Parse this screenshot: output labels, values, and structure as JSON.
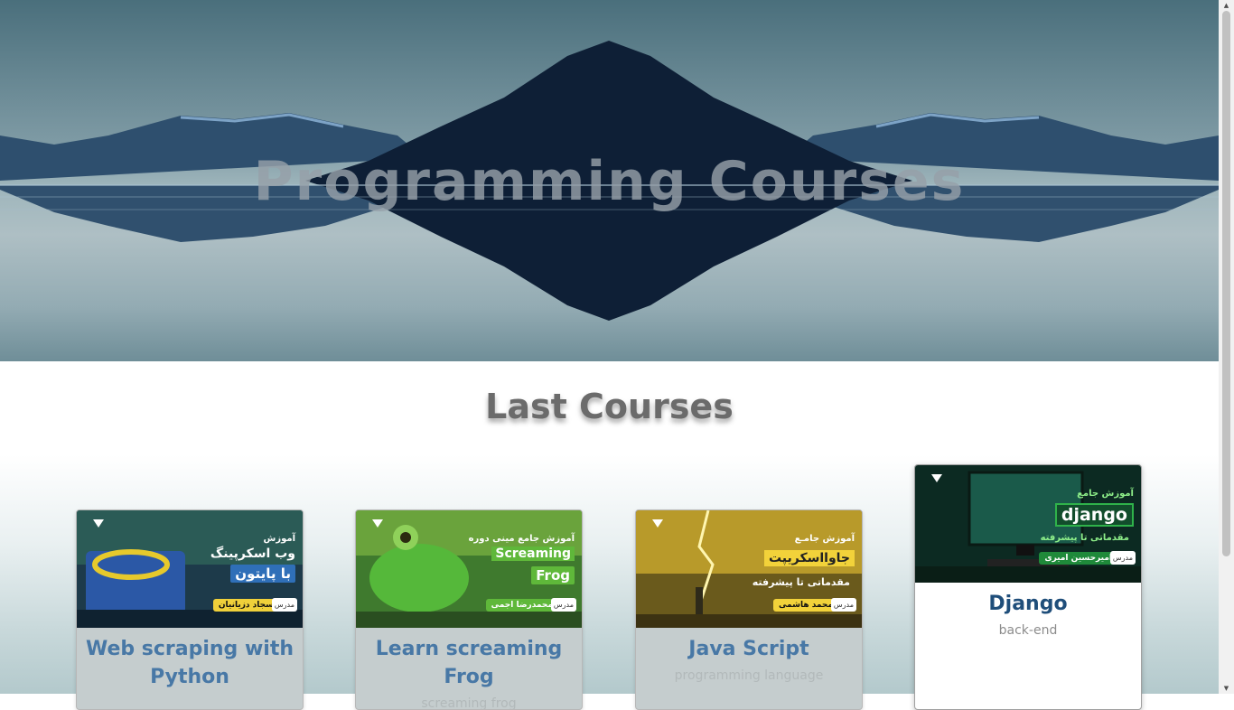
{
  "hero": {
    "title": "Programming Courses"
  },
  "section": {
    "title": "Last Courses"
  },
  "courses": [
    {
      "title": "Web scraping with Python",
      "subtitle": "",
      "thumb": {
        "kicker": "آموزش",
        "line1": "وب اسکرپینگ",
        "line2": "با پایتون",
        "badge": "سجاد دزیانیان",
        "badge_tag": "مدرس",
        "accent": "#2f6fb8"
      }
    },
    {
      "title": "Learn screaming Frog",
      "subtitle": "screaming frog",
      "thumb": {
        "kicker": "آموزش جامع  مینی دوره",
        "line1": "Screaming",
        "line2": "Frog",
        "badge": "محمدرضا اجمی",
        "badge_tag": "مدرس",
        "accent": "#5fb83a"
      }
    },
    {
      "title": "Java Script",
      "subtitle": "programming language",
      "thumb": {
        "kicker": "آموزش جامـع",
        "line1": "جاوااسکریپت",
        "line2": "مقدماتی تا پیشرفته",
        "badge": "محمد هاشمی",
        "badge_tag": "مدرس",
        "accent": "#f2d23a"
      }
    },
    {
      "title": "Django",
      "subtitle": "back-end",
      "thumb": {
        "kicker": "آموزش جامع",
        "line1": "django",
        "line2": "مقدماتی تا پیشرفته",
        "badge": "امیرحسین امیری",
        "badge_tag": "مدرس",
        "accent": "#1f8a3a"
      }
    }
  ]
}
